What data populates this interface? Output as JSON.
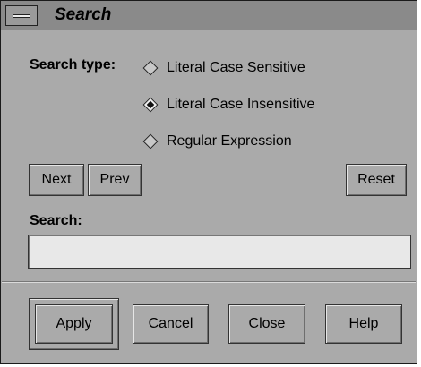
{
  "window": {
    "title": "Search",
    "colors": {
      "background": "#aaaaaa",
      "titlebar": "#8a8a8a",
      "field": "#e8e8e8"
    }
  },
  "search_type": {
    "label": "Search type:",
    "options": [
      {
        "label": "Literal Case Sensitive",
        "selected": false
      },
      {
        "label": "Literal Case Insensitive",
        "selected": true
      },
      {
        "label": "Regular Expression",
        "selected": false
      }
    ]
  },
  "nav": {
    "next_label": "Next",
    "prev_label": "Prev",
    "reset_label": "Reset"
  },
  "search": {
    "label": "Search:",
    "value": ""
  },
  "actions": {
    "apply_label": "Apply",
    "cancel_label": "Cancel",
    "close_label": "Close",
    "help_label": "Help"
  },
  "icons": {
    "window_menu": "window-menu-icon",
    "radio_off": "radio-diamond-icon",
    "radio_on": "radio-diamond-selected-icon"
  }
}
